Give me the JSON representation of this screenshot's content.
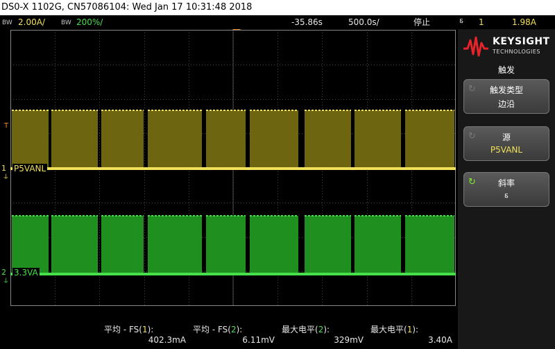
{
  "window": {
    "title": "DS0-X 1102G, CN57086104: Wed Jan 17 10:31:48 2018"
  },
  "status": {
    "ch1_bw": "BW",
    "ch1_scale": "2.00A/",
    "ch2_bw": "BW",
    "ch2_scale": "200%/",
    "time_offset": "-35.86s",
    "time_scale": "500.0s/",
    "run_state": "停止",
    "trigger_slope_glyph": "⸹",
    "trigger_channel": "1",
    "trigger_level": "1.98A"
  },
  "channels": {
    "ch1": {
      "number": "1",
      "name": "P5VANL",
      "color": "#f2e15a"
    },
    "ch2": {
      "number": "2",
      "name": "3.3VA",
      "color": "#46e04a"
    },
    "trigger_marker": "T"
  },
  "measurements": [
    {
      "label": "平均 - FS(",
      "ch": "1",
      "suffix": "):",
      "value": "402.3mA"
    },
    {
      "label": "平均 - FS(",
      "ch": "2",
      "suffix": "):",
      "value": "6.11mV"
    },
    {
      "label": "最大电平(",
      "ch": "2",
      "suffix": "):",
      "value": "329mV"
    },
    {
      "label": "最大电平(",
      "ch": "1",
      "suffix": "):",
      "value": "3.40A"
    }
  ],
  "sidebar": {
    "brand": "KEYSIGHT",
    "brand_sub": "TECHNOLOGIES",
    "menu_title": "触发",
    "softkeys": [
      {
        "label": "触发类型",
        "value": "边沿",
        "icon": "rotate-icon"
      },
      {
        "label": "源",
        "value": "P5VANL",
        "icon": "rotate-icon"
      },
      {
        "label": "斜率",
        "value": "⸹",
        "icon": "rotate-icon"
      }
    ]
  },
  "colors": {
    "ch1": "#f2e15a",
    "ch2": "#46e04a",
    "trigger": "#f08a24",
    "grid": "#4a4a4a"
  }
}
